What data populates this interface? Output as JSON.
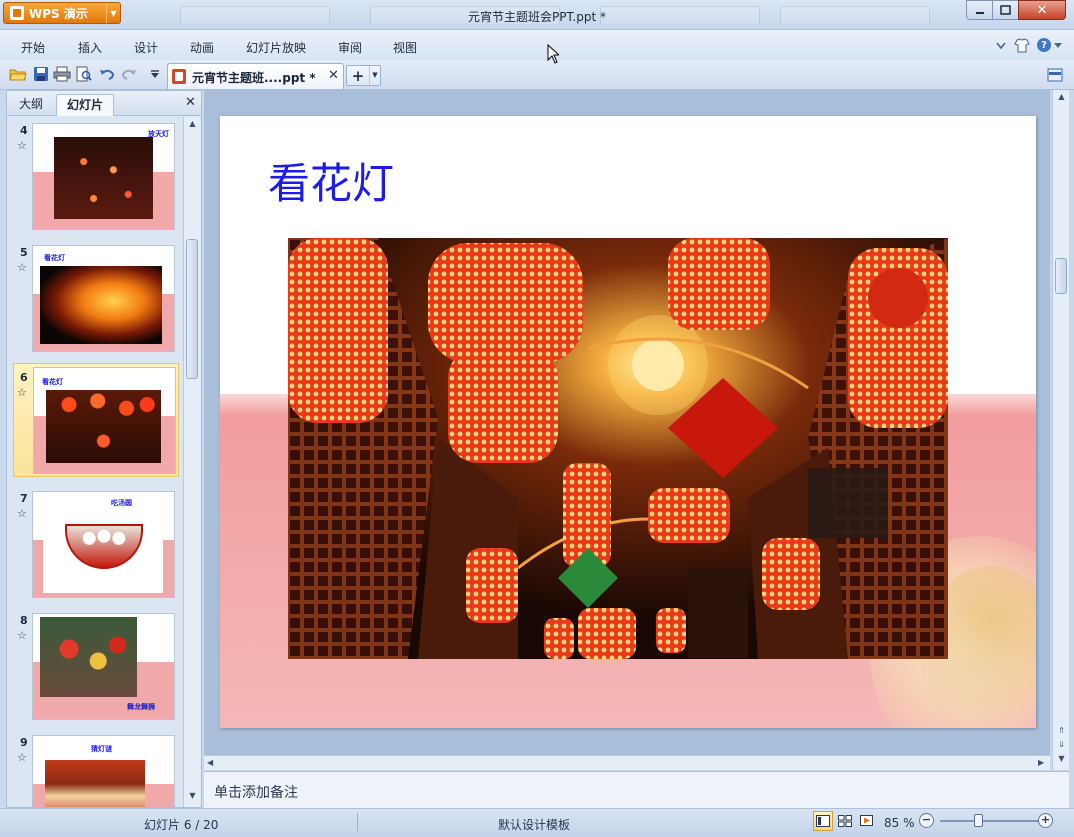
{
  "app": {
    "badge": "WPS 演示",
    "window_title": "元宵节主题班会PPT.ppt *"
  },
  "menu": [
    "开始",
    "插入",
    "设计",
    "动画",
    "幻灯片放映",
    "审阅",
    "视图"
  ],
  "document_tab": {
    "label": "元宵节主题班....ppt *"
  },
  "left_panel": {
    "tabs": [
      "大纲",
      "幻灯片"
    ],
    "thumbnails": [
      {
        "number": "4",
        "title": "放天灯",
        "selected": false
      },
      {
        "number": "5",
        "title": "看花灯",
        "selected": false
      },
      {
        "number": "6",
        "title": "看花灯",
        "selected": true
      },
      {
        "number": "7",
        "title": "吃汤圆",
        "selected": false
      },
      {
        "number": "8",
        "title": "舞龙舞狮",
        "selected": false
      },
      {
        "number": "9",
        "title": "猜灯谜",
        "selected": false
      }
    ]
  },
  "slide": {
    "title": "看花灯"
  },
  "notes": {
    "placeholder": "单击添加备注"
  },
  "status": {
    "slide_counter": "幻灯片 6 / 20",
    "template": "默认设计模板",
    "zoom": "85 %"
  },
  "colors": {
    "title_blue": "#1c1ce6",
    "wps_orange": "#e1780a",
    "slide_pink": "#f29d9d"
  }
}
